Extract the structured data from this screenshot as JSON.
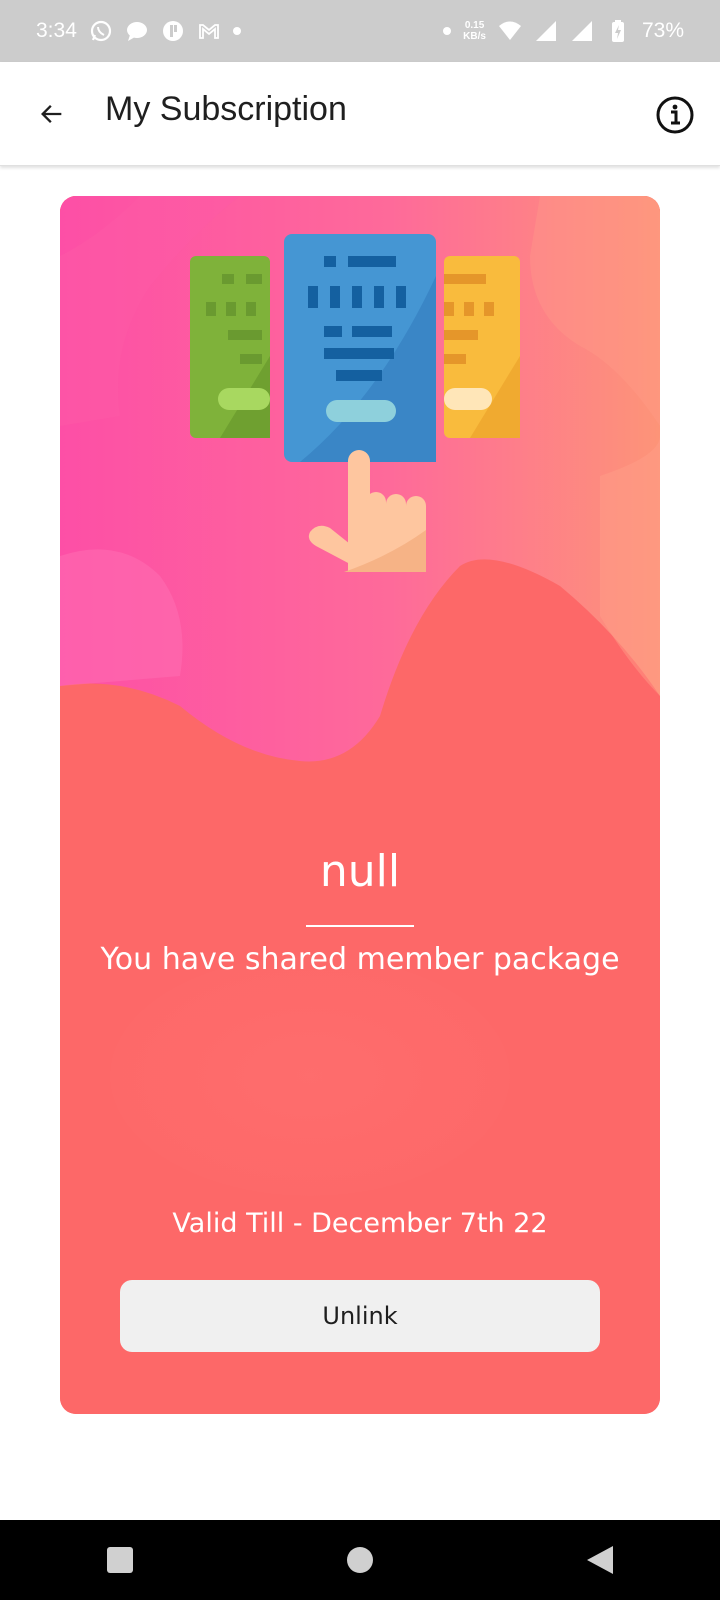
{
  "status_bar": {
    "time": "3:34",
    "net_speed_value": "0.15",
    "net_speed_unit": "KB/s",
    "battery": "73%",
    "left_icons": [
      "whatsapp-icon",
      "message-icon",
      "app-icon",
      "gmail-icon",
      "dot-icon"
    ],
    "right_icons": [
      "dot-icon",
      "wifi-icon",
      "signal-icon",
      "signal-icon",
      "battery-charging-icon"
    ]
  },
  "app_bar": {
    "title": "My Subscription",
    "back_icon": "arrow-left-icon",
    "info_icon": "info-icon"
  },
  "card": {
    "plan_name": "null",
    "message": "You have shared member package",
    "valid_till": "Valid Till - December 7th 22",
    "unlink_label": "Unlink",
    "colors": {
      "gradient_left": "#fd4fa6",
      "gradient_right": "#fd8a70",
      "base": "#fd6868",
      "button": "#f0f0f0"
    }
  },
  "nav_bar": {
    "icons": [
      "recents-square-icon",
      "home-circle-icon",
      "back-triangle-icon"
    ]
  }
}
